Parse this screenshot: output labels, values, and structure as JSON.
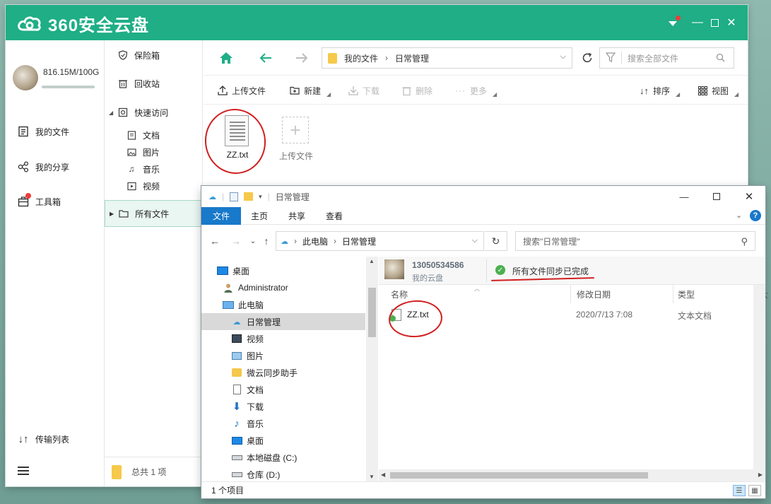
{
  "app360": {
    "logo_text": "360安全云盘",
    "quota": "816.15M/100G",
    "quota_used_fraction": 0.008,
    "nav": [
      {
        "label": "我的文件",
        "icon": "file-list-icon"
      },
      {
        "label": "我的分享",
        "icon": "share-icon"
      },
      {
        "label": "工具箱",
        "icon": "toolbox-icon"
      }
    ],
    "bottom_nav": {
      "transfer": "传输列表",
      "menu_icon": "hamburger-icon"
    },
    "tree": [
      {
        "label": "保险箱"
      },
      {
        "label": "回收站"
      },
      {
        "label": "快速访问"
      },
      {
        "label": "文档"
      },
      {
        "label": "图片"
      },
      {
        "label": "音乐"
      },
      {
        "label": "视频"
      },
      {
        "label": "所有文件"
      }
    ],
    "tree_footer": "总共 1 项",
    "path": {
      "root": "我的文件",
      "current": "日常管理"
    },
    "search_placeholder": "搜索全部文件",
    "actions": {
      "upload": "上传文件",
      "new": "新建",
      "download": "下载",
      "delete": "删除",
      "more": "更多",
      "sort": "排序",
      "view": "视图"
    },
    "files": [
      {
        "name": "ZZ.txt"
      }
    ],
    "upload_tile": "上传文件"
  },
  "explorer": {
    "title": "日常管理",
    "ribbon_tabs": [
      "文件",
      "主页",
      "共享",
      "查看"
    ],
    "path": {
      "pc": "此电脑",
      "folder": "日常管理"
    },
    "search_placeholder": "搜索\"日常管理\"",
    "tree": [
      {
        "label": "桌面"
      },
      {
        "label": "Administrator"
      },
      {
        "label": "此电脑"
      },
      {
        "label": "日常管理"
      },
      {
        "label": "视频"
      },
      {
        "label": "图片"
      },
      {
        "label": "微云同步助手"
      },
      {
        "label": "文档"
      },
      {
        "label": "下载"
      },
      {
        "label": "音乐"
      },
      {
        "label": "桌面"
      },
      {
        "label": "本地磁盘 (C:)"
      },
      {
        "label": "仓库 (D:)"
      }
    ],
    "account": {
      "id": "13050534586",
      "sub": "我的云盘"
    },
    "sync_status": "所有文件同步已完成",
    "columns": [
      "名称",
      "修改日期",
      "类型",
      "大"
    ],
    "rows": [
      {
        "name": "ZZ.txt",
        "date": "2020/7/13 7:08",
        "type": "文本文档"
      }
    ],
    "status": "1 个项目"
  },
  "colors": {
    "brand": "#1fae85",
    "annotation": "#d11f1f",
    "explorer_accent": "#1979ca"
  }
}
